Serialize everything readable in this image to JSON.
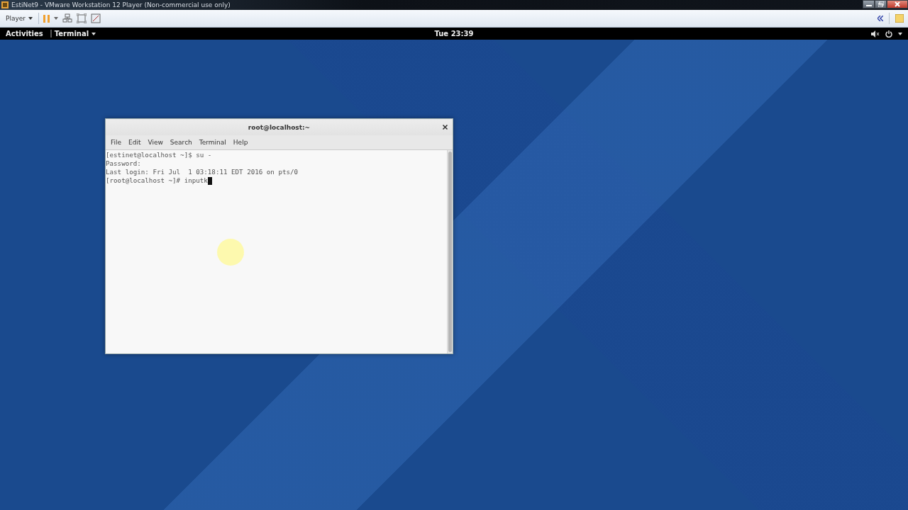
{
  "vm_window": {
    "title": "EstiNet9 - VMware Workstation 12 Player (Non-commercial use only)"
  },
  "vm_toolbar": {
    "menu": "Player"
  },
  "top_bar": {
    "activities": "Activities",
    "app_menu": "Terminal",
    "clock": "Tue 23:39"
  },
  "terminal": {
    "title": "root@localhost:~",
    "menu": [
      "File",
      "Edit",
      "View",
      "Search",
      "Terminal",
      "Help"
    ],
    "lines": [
      "[estinet@localhost ~]$ su -",
      "Password:",
      "Last login: Fri Jul  1 03:18:11 EDT 2016 on pts/0",
      "[root@localhost ~]# inputk"
    ]
  }
}
